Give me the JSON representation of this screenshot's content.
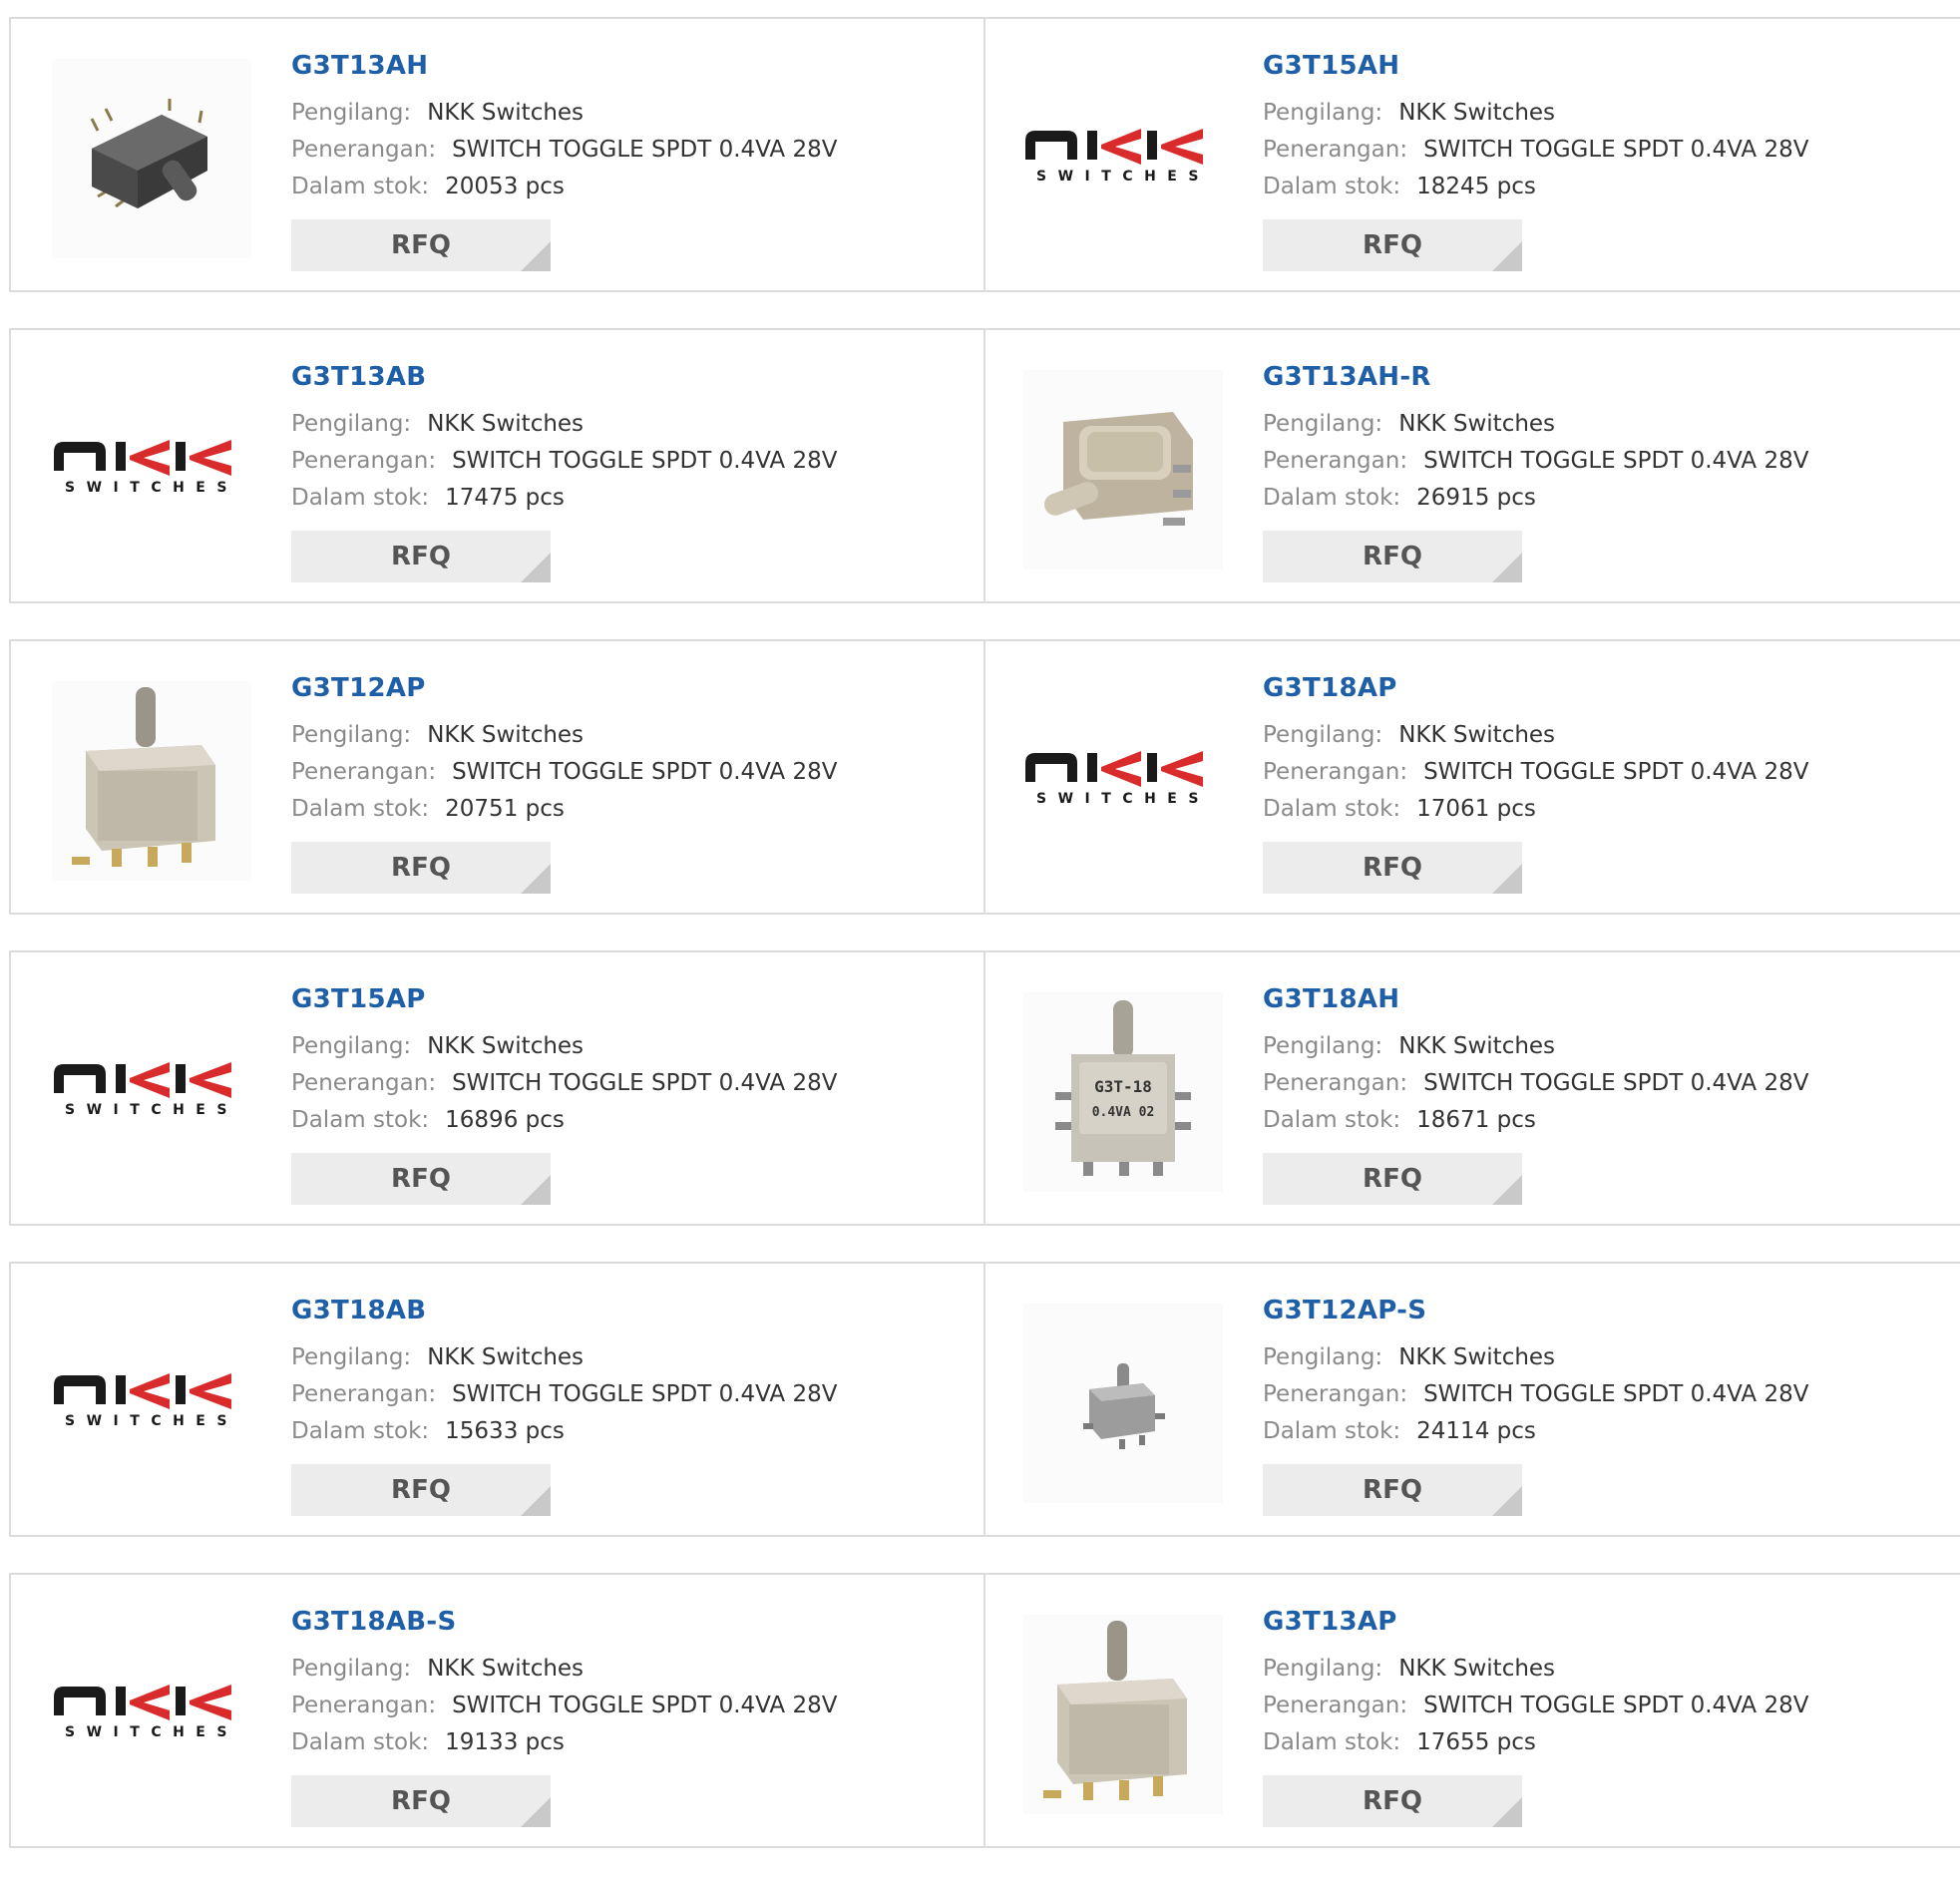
{
  "labels": {
    "manufacturer": "Pengilang:",
    "description": "Penerangan:",
    "stock": "Dalam stok:",
    "rfq": "RFQ"
  },
  "logo": {
    "brand": "NKK",
    "tagline": "SWITCHES"
  },
  "colors": {
    "title": "#1e5fa8",
    "label": "#8a8a8a",
    "value": "#333333",
    "button_bg": "#ececec",
    "border": "#dcdcdc",
    "logo_red": "#d92b2b",
    "logo_black": "#1a1a1a"
  },
  "products": [
    {
      "part": "G3T13AH",
      "manufacturer": "NKK Switches",
      "description": "SWITCH TOGGLE SPDT 0.4VA 28V",
      "stock": "20053 pcs",
      "image": "dark-toggle-switch"
    },
    {
      "part": "G3T15AH",
      "manufacturer": "NKK Switches",
      "description": "SWITCH TOGGLE SPDT 0.4VA 28V",
      "stock": "18245 pcs",
      "image": "nkk-logo"
    },
    {
      "part": "G3T13AB",
      "manufacturer": "NKK Switches",
      "description": "SWITCH TOGGLE SPDT 0.4VA 28V",
      "stock": "17475 pcs",
      "image": "nkk-logo"
    },
    {
      "part": "G3T13AH-R",
      "manufacturer": "NKK Switches",
      "description": "SWITCH TOGGLE SPDT 0.4VA 28V",
      "stock": "26915 pcs",
      "image": "beige-toggle-switch"
    },
    {
      "part": "G3T12AP",
      "manufacturer": "NKK Switches",
      "description": "SWITCH TOGGLE SPDT 0.4VA 28V",
      "stock": "20751 pcs",
      "image": "upright-toggle-switch"
    },
    {
      "part": "G3T18AP",
      "manufacturer": "NKK Switches",
      "description": "SWITCH TOGGLE SPDT 0.4VA 28V",
      "stock": "17061 pcs",
      "image": "nkk-logo"
    },
    {
      "part": "G3T15AP",
      "manufacturer": "NKK Switches",
      "description": "SWITCH TOGGLE SPDT 0.4VA 28V",
      "stock": "16896 pcs",
      "image": "nkk-logo"
    },
    {
      "part": "G3T18AH",
      "manufacturer": "NKK Switches",
      "description": "SWITCH TOGGLE SPDT 0.4VA 28V",
      "stock": "18671 pcs",
      "image": "labeled-toggle-switch",
      "image_text": [
        "G3T-18",
        "0.4VA 02"
      ]
    },
    {
      "part": "G3T18AB",
      "manufacturer": "NKK Switches",
      "description": "SWITCH TOGGLE SPDT 0.4VA 28V",
      "stock": "15633 pcs",
      "image": "nkk-logo"
    },
    {
      "part": "G3T12AP-S",
      "manufacturer": "NKK Switches",
      "description": "SWITCH TOGGLE SPDT 0.4VA 28V",
      "stock": "24114 pcs",
      "image": "small-toggle-switch"
    },
    {
      "part": "G3T18AB-S",
      "manufacturer": "NKK Switches",
      "description": "SWITCH TOGGLE SPDT 0.4VA 28V",
      "stock": "19133 pcs",
      "image": "nkk-logo"
    },
    {
      "part": "G3T13AP",
      "manufacturer": "NKK Switches",
      "description": "SWITCH TOGGLE SPDT 0.4VA 28V",
      "stock": "17655 pcs",
      "image": "upright-toggle-switch"
    }
  ]
}
